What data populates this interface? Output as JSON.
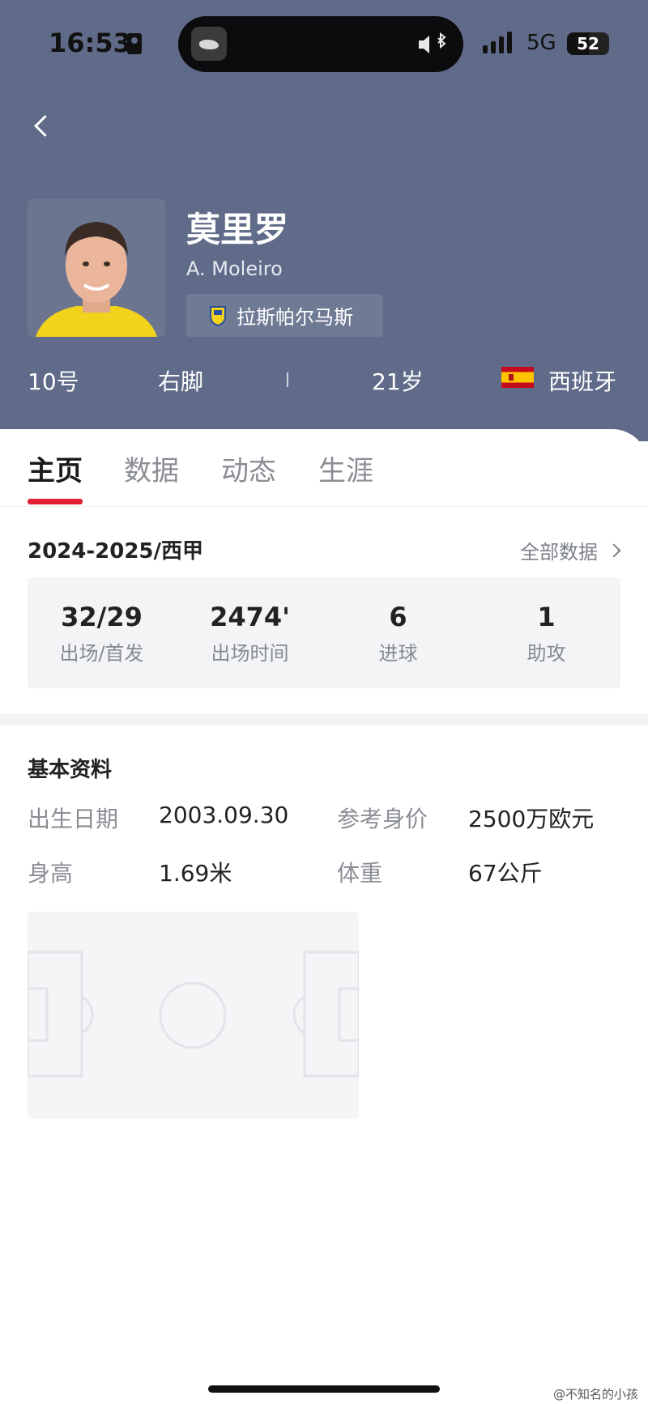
{
  "status_bar": {
    "time": "16:53",
    "network": "5G",
    "battery": "52"
  },
  "player": {
    "name": "莫里罗",
    "english_name": "A. Moleiro",
    "club": "拉斯帕尔马斯",
    "number": "10号",
    "foot": "右脚",
    "age": "21岁",
    "nationality": "西班牙"
  },
  "tabs": [
    {
      "label": "主页",
      "active": true
    },
    {
      "label": "数据",
      "active": false
    },
    {
      "label": "动态",
      "active": false
    },
    {
      "label": "生涯",
      "active": false
    }
  ],
  "season": {
    "title": "2024-2025/西甲",
    "all_data_link": "全部数据",
    "stats": [
      {
        "value": "32/29",
        "label": "出场/首发"
      },
      {
        "value": "2474'",
        "label": "出场时间"
      },
      {
        "value": "6",
        "label": "进球"
      },
      {
        "value": "1",
        "label": "助攻"
      }
    ]
  },
  "basic_info": {
    "title": "基本资料",
    "rows": [
      {
        "k1": "出生日期",
        "v1": "2003.09.30",
        "k2": "参考身价",
        "v2": "2500万欧元"
      },
      {
        "k1": "身高",
        "v1": "1.69米",
        "k2": "体重",
        "v2": "67公斤"
      }
    ]
  },
  "watermark": "@不知名的小孩",
  "colors": {
    "header_bg": "#5f6b89",
    "accent": "#e02032",
    "stat_bg": "#f3f4f6"
  }
}
